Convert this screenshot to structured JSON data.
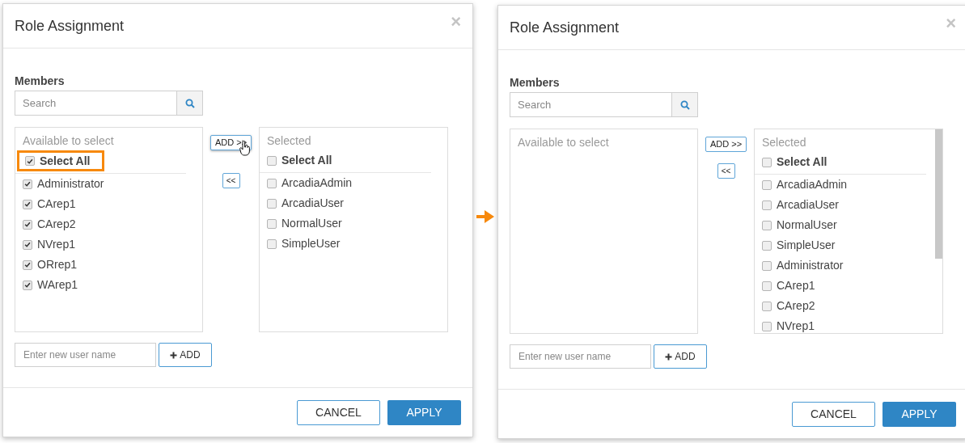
{
  "dialogs": [
    {
      "title": "Role Assignment",
      "close": "×",
      "members_label": "Members",
      "search": {
        "placeholder": "Search"
      },
      "available": {
        "heading": "Available to select",
        "select_all": {
          "label": "Select All",
          "checked": true,
          "highlighted": true
        },
        "items": [
          {
            "label": "Administrator",
            "checked": true
          },
          {
            "label": "CArep1",
            "checked": true
          },
          {
            "label": "CArep2",
            "checked": true
          },
          {
            "label": "NVrep1",
            "checked": true
          },
          {
            "label": "ORrep1",
            "checked": true
          },
          {
            "label": "WArep1",
            "checked": true
          }
        ]
      },
      "add_button": {
        "label": "ADD >>",
        "hovered": true
      },
      "remove_button": "<<",
      "selected": {
        "heading": "Selected",
        "select_all": {
          "label": "Select All",
          "checked": false,
          "highlighted": false
        },
        "items": [
          {
            "label": "ArcadiaAdmin",
            "checked": false
          },
          {
            "label": "ArcadiaUser",
            "checked": false
          },
          {
            "label": "NormalUser",
            "checked": false
          },
          {
            "label": "SimpleUser",
            "checked": false
          }
        ]
      },
      "new_user": {
        "placeholder": "Enter new user name"
      },
      "add_user_button": "ADD",
      "cancel": "CANCEL",
      "apply": "APPLY"
    },
    {
      "title": "Role Assignment",
      "close": "×",
      "members_label": "Members",
      "search": {
        "placeholder": "Search"
      },
      "available": {
        "heading": "Available to select"
      },
      "add_button": {
        "label": "ADD >>",
        "hovered": false
      },
      "remove_button": "<<",
      "selected": {
        "heading": "Selected",
        "select_all": {
          "label": "Select All",
          "checked": false,
          "highlighted": false
        },
        "items": [
          {
            "label": "ArcadiaAdmin",
            "checked": false
          },
          {
            "label": "ArcadiaUser",
            "checked": false
          },
          {
            "label": "NormalUser",
            "checked": false
          },
          {
            "label": "SimpleUser",
            "checked": false
          },
          {
            "label": "Administrator",
            "checked": false
          },
          {
            "label": "CArep1",
            "checked": false
          },
          {
            "label": "CArep2",
            "checked": false
          },
          {
            "label": "NVrep1",
            "checked": false
          }
        ]
      },
      "new_user": {
        "placeholder": "Enter new user name"
      },
      "add_user_button": "ADD",
      "cancel": "CANCEL",
      "apply": "APPLY"
    }
  ]
}
